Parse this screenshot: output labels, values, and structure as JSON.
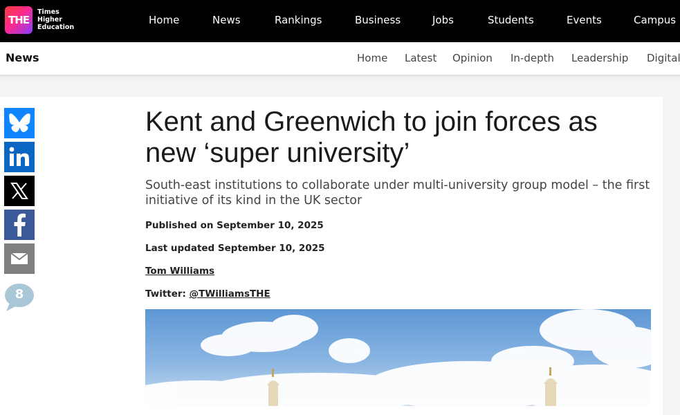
{
  "brand": {
    "logo_mark": "THE",
    "name_lines": [
      "Times",
      "Higher",
      "Education"
    ]
  },
  "main_nav": [
    "Home",
    "News",
    "Rankings",
    "Business",
    "Jobs",
    "Students",
    "Events",
    "Campus"
  ],
  "sub_nav": {
    "section_title": "News",
    "items": [
      "Home",
      "Latest",
      "Opinion",
      "In-depth",
      "Leadership",
      "Digital"
    ]
  },
  "share": {
    "icons": [
      "bluesky-icon",
      "linkedin-icon",
      "x-icon",
      "facebook-icon",
      "email-icon"
    ],
    "comment_count": "8",
    "colors": {
      "bluesky": "#1185fe",
      "linkedin": "#0a66c2",
      "x": "#000000",
      "facebook": "#3b5998",
      "email": "#7f7f7f",
      "comment": "#a9c6d6"
    }
  },
  "article": {
    "headline": "Kent and Greenwich to join forces as new ‘super university’",
    "standfirst": "South-east institutions to collaborate under multi-university group model – the first initiative of its kind in the UK sector",
    "published": "Published on September 10, 2025",
    "updated": "Last updated September 10, 2025",
    "author": "Tom Williams",
    "twitter_label": "Twitter:",
    "twitter_handle": "@TWilliamsTHE"
  },
  "colors": {
    "topbar_bg": "#000000",
    "page_bg": "#f4f4f4",
    "text": "#1a1a1a"
  }
}
